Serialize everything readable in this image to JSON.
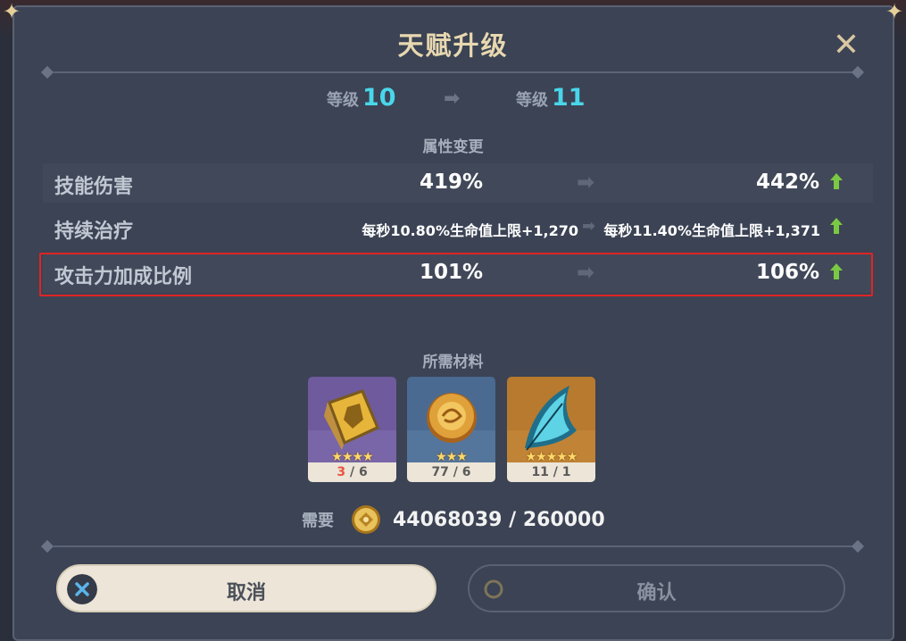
{
  "title": "天赋升级",
  "level": {
    "label": "等级",
    "current": "10",
    "next": "11"
  },
  "stats_section_label": "属性变更",
  "stats": [
    {
      "name": "技能伤害",
      "old": "419%",
      "new": "442%"
    },
    {
      "name": "持续治疗",
      "old": "每秒10.80%生命值上限+1,270",
      "new": "每秒11.40%生命值上限+1,371"
    },
    {
      "name": "攻击力加成比例",
      "old": "101%",
      "new": "106%"
    }
  ],
  "materials_section_label": "所需材料",
  "materials": [
    {
      "icon": "talent-book-icon",
      "stars": "★★★★",
      "owned": "3",
      "required": "6",
      "bg": "#6e5a9c"
    },
    {
      "icon": "bronze-coin-material-icon",
      "stars": "★★★",
      "owned": "77",
      "required": "6",
      "bg": "#4a6a92"
    },
    {
      "icon": "blue-feather-material-icon",
      "stars": "★★★★★",
      "owned": "11",
      "required": "1",
      "bg": "#b87a2e"
    }
  ],
  "cost": {
    "label": "需要",
    "value": "44068039 / 260000",
    "icon": "mora-coin-icon"
  },
  "buttons": {
    "cancel": "取消",
    "confirm": "确认"
  },
  "colors": {
    "accent_cyan": "#4ad6ea",
    "highlight_red": "#e02424",
    "up_arrow_green": "#7ac943",
    "deficit_red": "#e8553f"
  }
}
